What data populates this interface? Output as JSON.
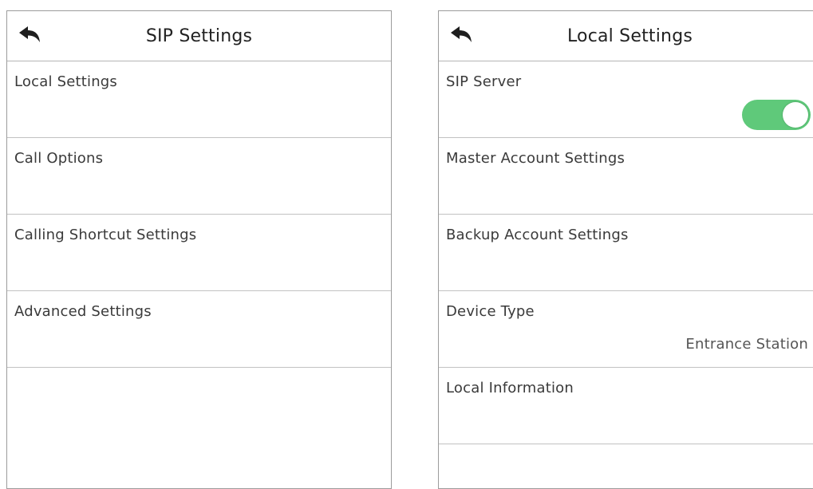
{
  "left_panel": {
    "title": "SIP Settings",
    "items": [
      {
        "label": "Local Settings"
      },
      {
        "label": "Call Options"
      },
      {
        "label": "Calling Shortcut Settings"
      },
      {
        "label": "Advanced Settings"
      }
    ]
  },
  "right_panel": {
    "title": "Local Settings",
    "items": [
      {
        "label": "SIP Server",
        "toggle_on": true
      },
      {
        "label": "Master Account Settings"
      },
      {
        "label": "Backup Account Settings"
      },
      {
        "label": "Device Type",
        "value": "Entrance Station"
      },
      {
        "label": "Local Information"
      }
    ]
  },
  "icons": {
    "back": "back-arrow-icon"
  },
  "colors": {
    "toggle_on": "#5fc97a",
    "divider": "#c2c2c2",
    "panel_border": "#9c9c9c"
  }
}
